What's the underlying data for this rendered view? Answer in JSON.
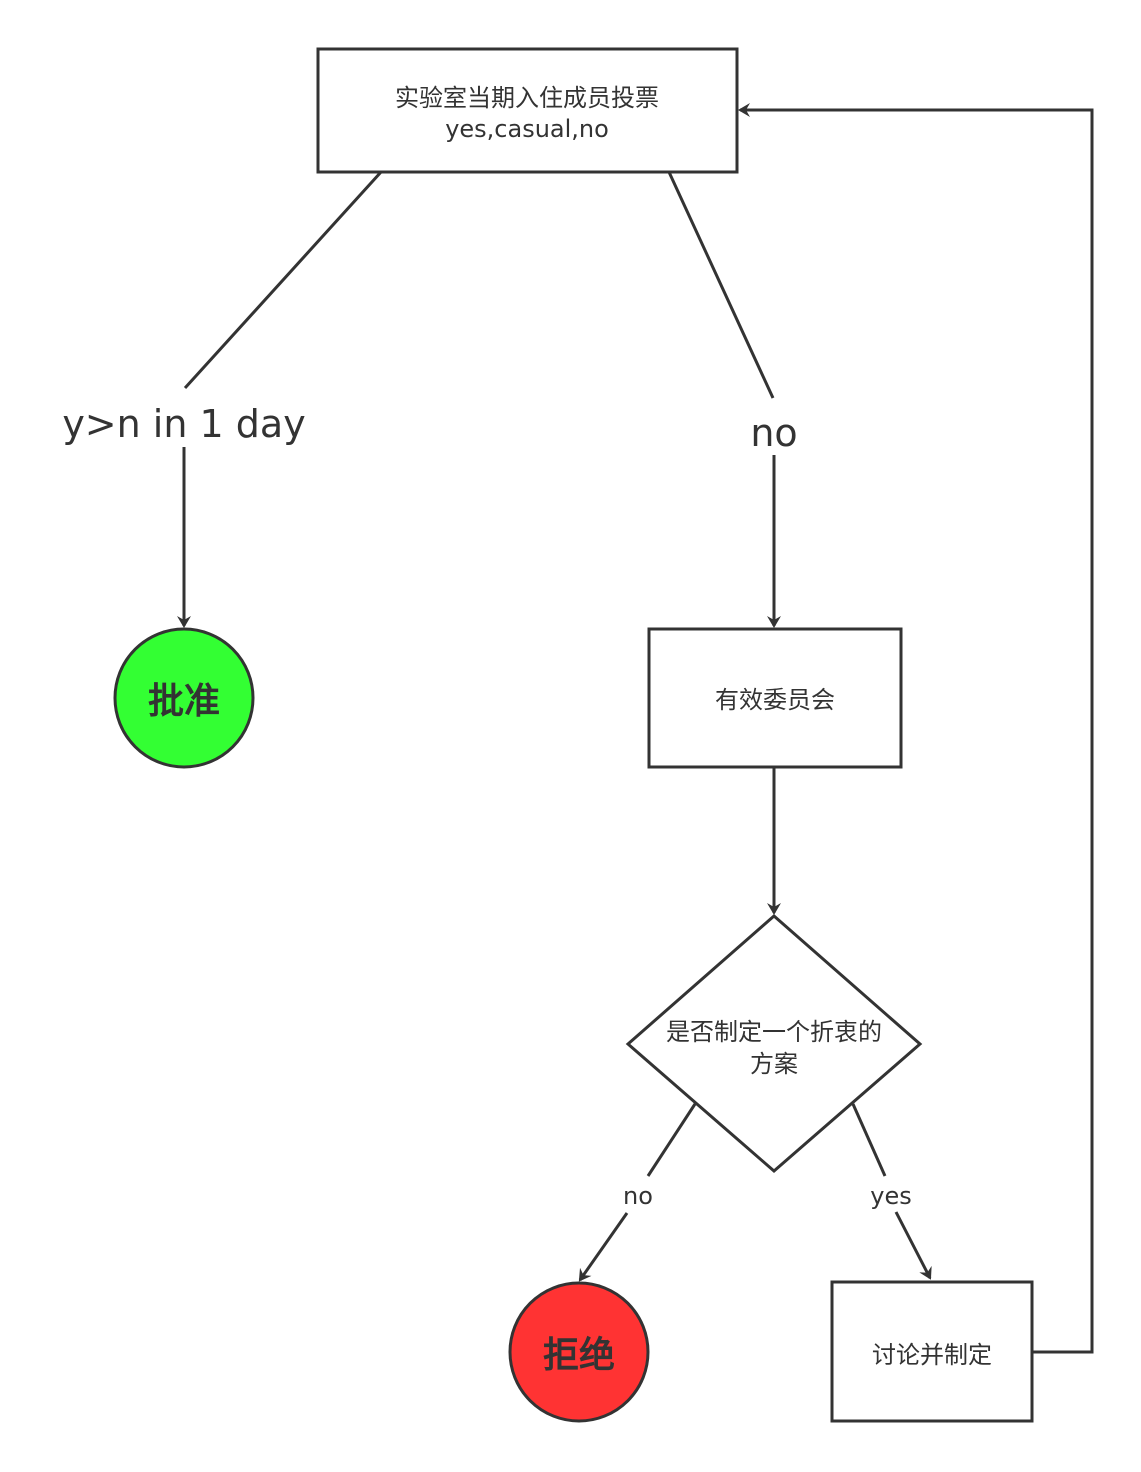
{
  "nodes": {
    "vote": {
      "line1": "实验室当期入住成员投票",
      "line2": "yes,casual,no"
    },
    "approve": {
      "label": "批准",
      "color": "#33ff33"
    },
    "committee": {
      "label": "有效委员会"
    },
    "decision": {
      "line1": "是否制定一个折衷的",
      "line2": "方案"
    },
    "reject": {
      "label": "拒绝",
      "color": "#ff3333"
    },
    "discuss": {
      "label": "讨论并制定"
    }
  },
  "edges": {
    "vote_to_approve": {
      "label": "y>n in 1 day"
    },
    "vote_to_committee": {
      "label": "no"
    },
    "decision_to_reject": {
      "label": "no"
    },
    "decision_to_discuss": {
      "label": "yes"
    }
  },
  "colors": {
    "stroke": "#333333",
    "text": "#333333"
  }
}
